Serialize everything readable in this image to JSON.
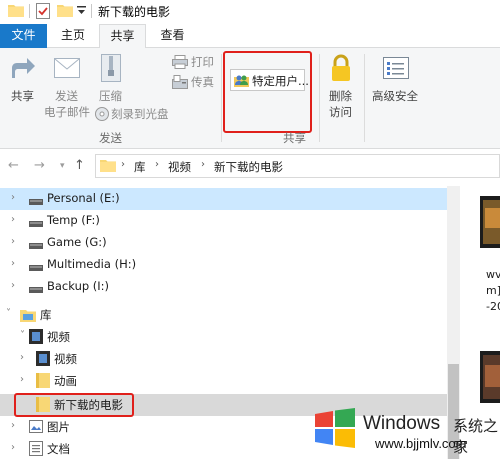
{
  "window": {
    "title": "新下载的电影"
  },
  "ribbon_tabs": {
    "file": "文件",
    "home": "主页",
    "share": "共享",
    "view": "查看"
  },
  "ribbon": {
    "share": "共享",
    "send_email_line1": "发送",
    "send_email_line2": "电子邮件",
    "zip": "压缩",
    "print": "打印",
    "fax": "传真",
    "burn": "刻录到光盘",
    "group_send": "发送",
    "specific_user": "特定用户...",
    "group_share": "共享",
    "remove_access_line1": "删除",
    "remove_access_line2": "访问",
    "advanced_security": "高级安全"
  },
  "address": {
    "crumbs": [
      "库",
      "视频",
      "新下载的电影"
    ]
  },
  "nav_tree": {
    "items": [
      {
        "label": "Personal (E:)"
      },
      {
        "label": "Temp (F:)"
      },
      {
        "label": "Game (G:)"
      },
      {
        "label": "Multimedia (H:)"
      },
      {
        "label": "Backup (I:)"
      },
      {
        "label": "库"
      },
      {
        "label": "视频"
      },
      {
        "label": "视频"
      },
      {
        "label": "动画"
      },
      {
        "label": "新下载的电影"
      },
      {
        "label": "图片"
      },
      {
        "label": "文档"
      }
    ]
  },
  "content": {
    "file_text": [
      "wv",
      "m]:",
      "-20"
    ]
  },
  "watermark": {
    "word": "Windows",
    "cn": "系统之家",
    "url": "www.bjjmlv.com"
  },
  "colors": {
    "accent": "#1979ca",
    "selection": "#cce8ff",
    "highlight_box": "#e0201b"
  }
}
